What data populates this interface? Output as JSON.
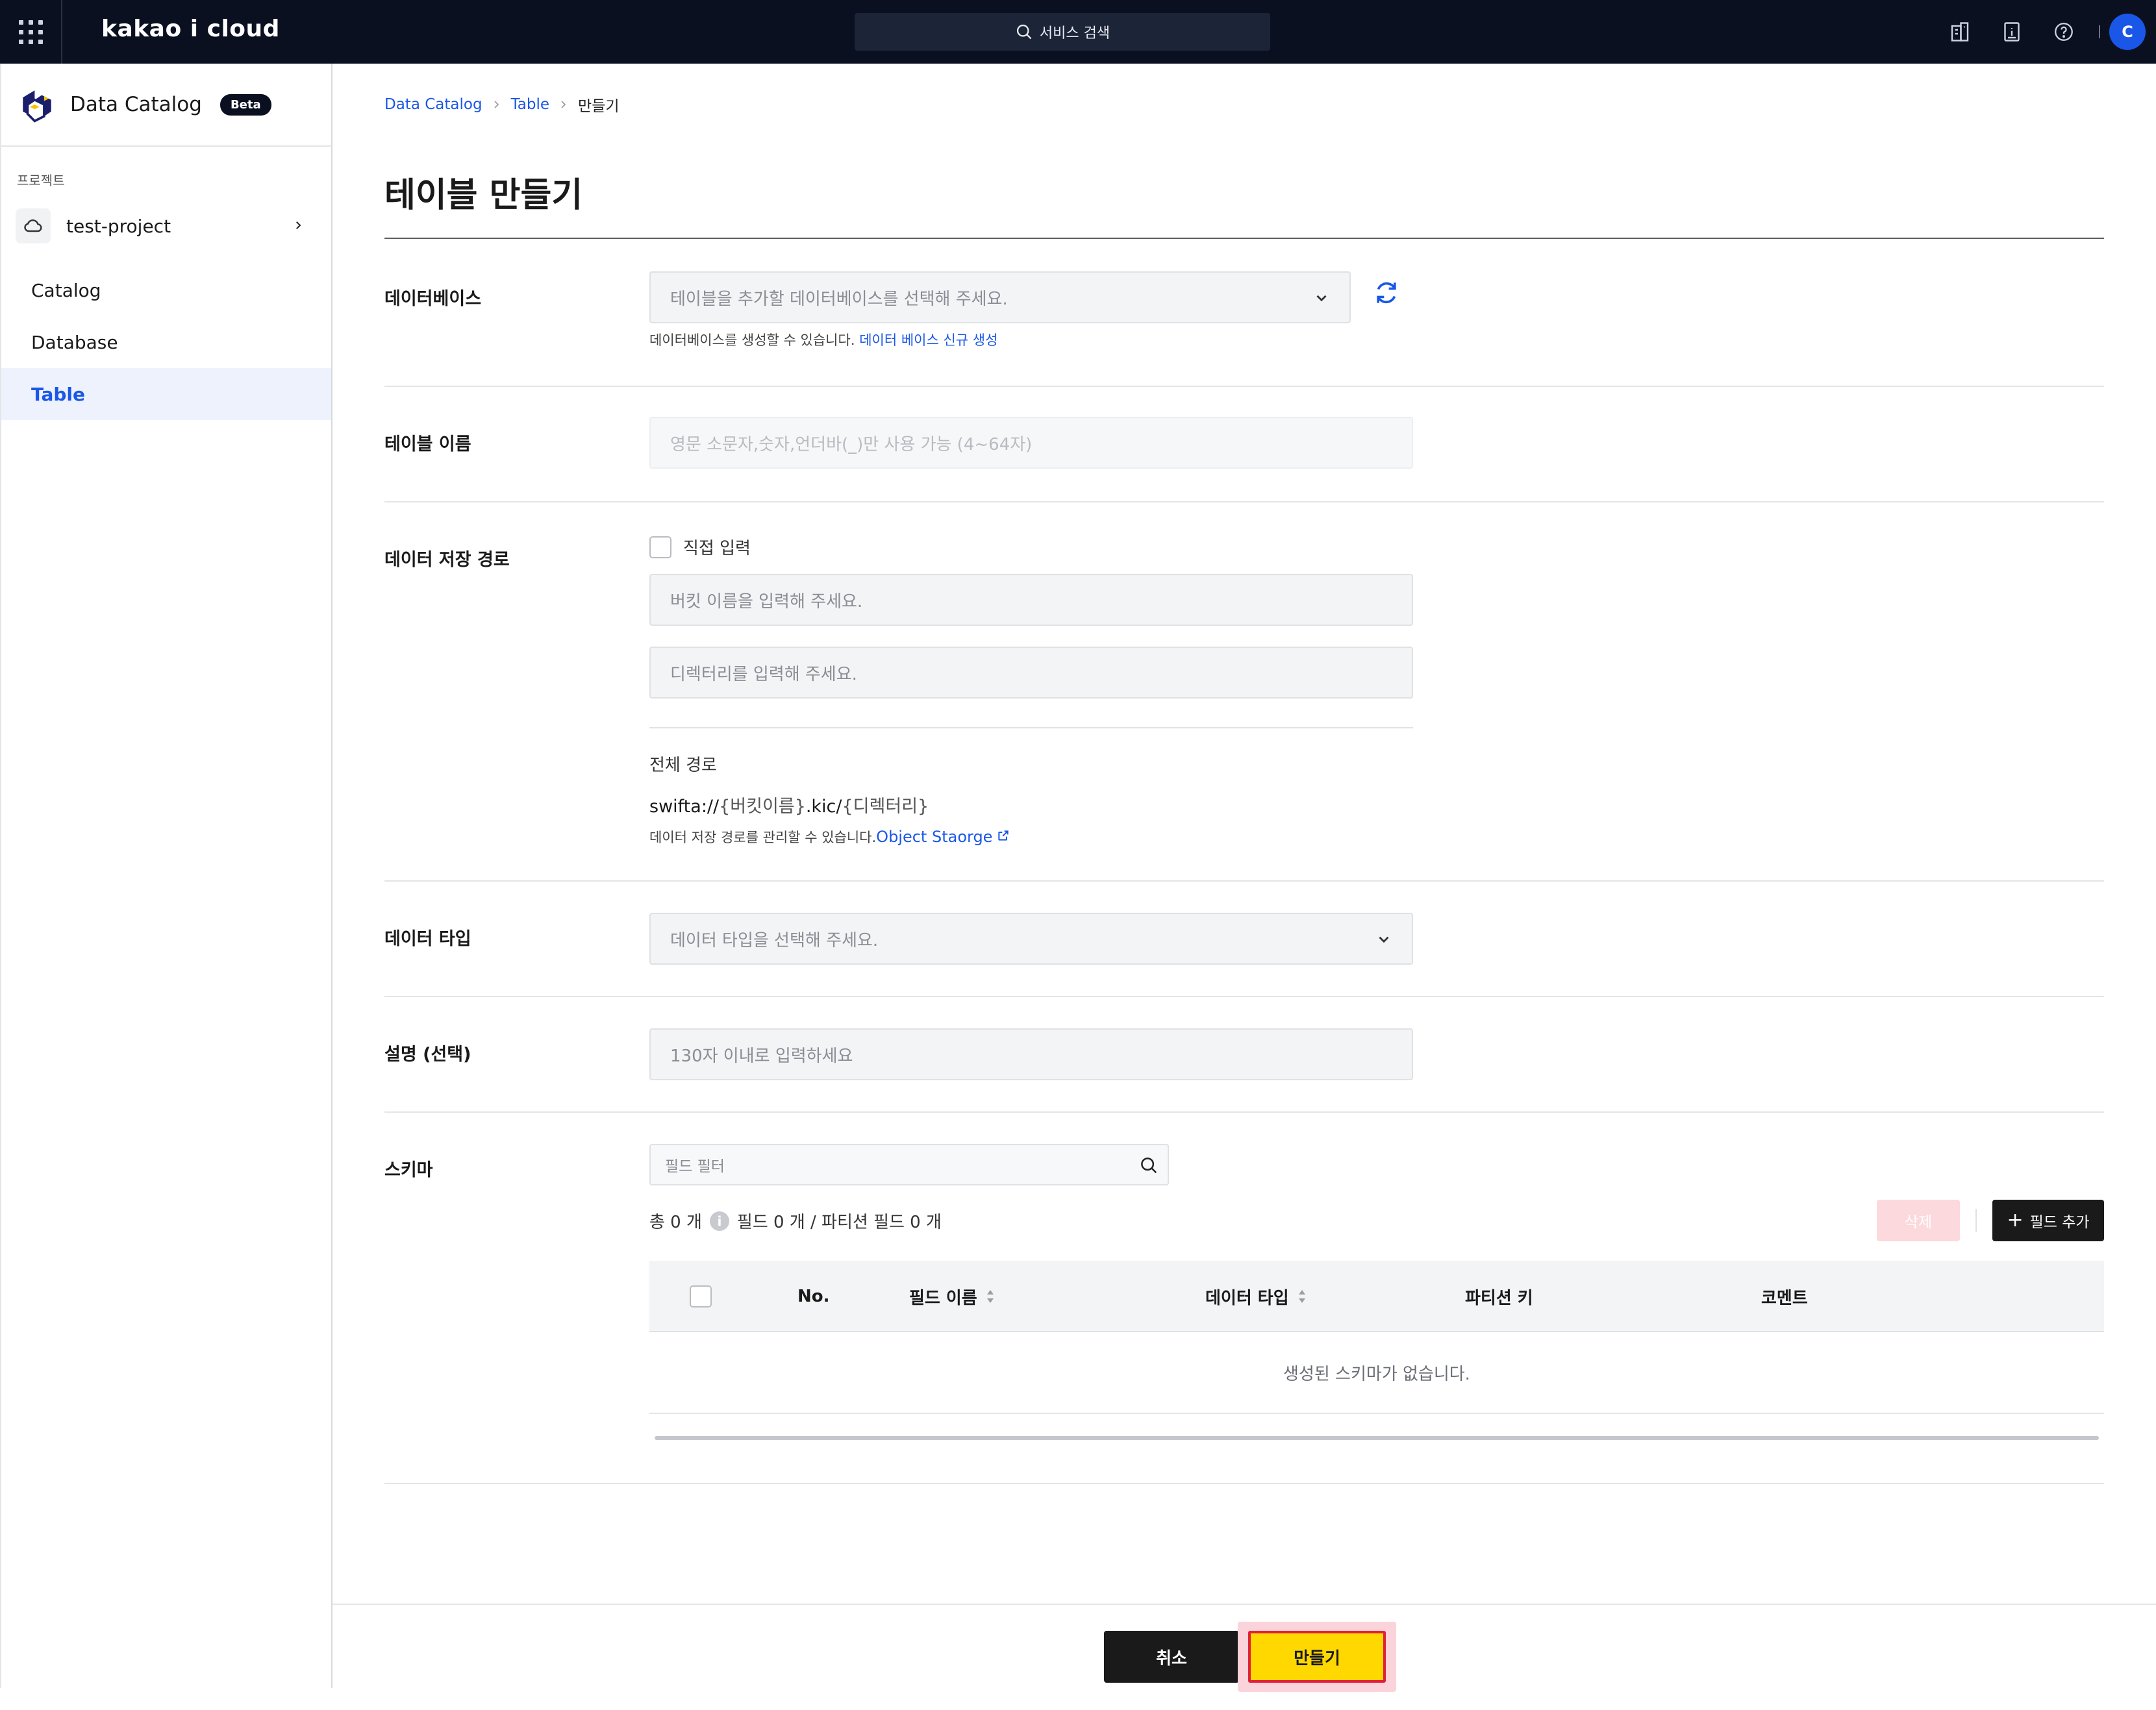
{
  "topbar": {
    "brand": "kakao i cloud",
    "search_placeholder": "서비스 검색",
    "avatar_initial": "C",
    "icons": [
      "apps-grid-icon",
      "search-icon",
      "building-icon",
      "document-icon",
      "help-icon"
    ]
  },
  "sidebar": {
    "title": "Data Catalog",
    "badge": "Beta",
    "project_label": "프로젝트",
    "project_name": "test-project",
    "items": [
      {
        "label": "Catalog",
        "active": false
      },
      {
        "label": "Database",
        "active": false
      },
      {
        "label": "Table",
        "active": true
      }
    ]
  },
  "breadcrumb": [
    "Data Catalog",
    "Table",
    "만들기"
  ],
  "page_title": "테이블 만들기",
  "form": {
    "database": {
      "label": "데이터베이스",
      "placeholder": "테이블을 추가할 데이터베이스를 선택해 주세요.",
      "helper": "데이터베이스를 생성할 수 있습니다.",
      "helper_link": "데이터 베이스 신규 생성"
    },
    "table_name": {
      "label": "테이블 이름",
      "placeholder": "영문 소문자,숫자,언더바(_)만 사용 가능 (4~64자)"
    },
    "storage_path": {
      "label": "데이터 저장 경로",
      "direct_input_label": "직접 입력",
      "bucket_placeholder": "버킷 이름을 입력해 주세요.",
      "directory_placeholder": "디렉터리를 입력해 주세요.",
      "full_path_label": "전체 경로",
      "full_path_prefix": "swifta://",
      "full_path_bucket": "{버킷이름}",
      "full_path_mid": ".kic/",
      "full_path_dir": "{디렉터리}",
      "helper": "데이터 저장 경로를 관리할 수 있습니다.",
      "helper_link": "Object Staorge"
    },
    "data_type": {
      "label": "데이터 타입",
      "placeholder": "데이터 타입을 선택해 주세요."
    },
    "description": {
      "label": "설명 (선택)",
      "placeholder": "130자 이내로 입력하세요"
    },
    "schema": {
      "label": "스키마",
      "filter_placeholder": "필드 필터",
      "total_text": "총 0 개",
      "info_icon": "i",
      "field_summary": "필드 0 개 / 파티션 필드 0 개",
      "delete_label": "삭제",
      "add_label": "필드 추가",
      "add_glyph": "+",
      "columns": [
        "No.",
        "필드 이름",
        "데이터 타입",
        "파티션 키",
        "코멘트"
      ],
      "empty_text": "생성된 스키마가 없습니다."
    }
  },
  "footer": {
    "cancel_label": "취소",
    "create_label": "만들기"
  }
}
